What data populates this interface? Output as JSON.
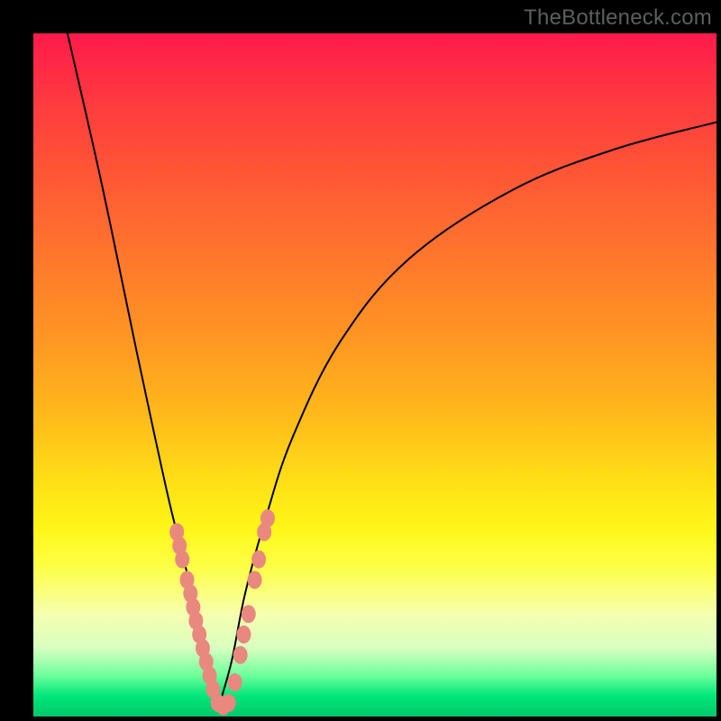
{
  "watermark": "TheBottleneck.com",
  "colors": {
    "frame": "#000000",
    "curve": "#000000",
    "dot": "#e9887f",
    "gradient_top": "#ff1a4b",
    "gradient_bottom": "#00c86a"
  },
  "chart_data": {
    "type": "line",
    "title": "",
    "xlabel": "",
    "ylabel": "",
    "xlim": [
      0,
      100
    ],
    "ylim": [
      0,
      100
    ],
    "description": "Bottleneck/mismatch curve: two black curves converge at a minimum near x≈27 with value ≈0, rising steeply to either side on a vertical color gradient (green at bottom = good, red at top = severe).",
    "series": [
      {
        "name": "left-curve",
        "x": [
          5,
          10,
          15,
          18,
          20,
          22,
          24,
          25,
          26,
          27
        ],
        "values": [
          100,
          78,
          54,
          40,
          31,
          23,
          15,
          10,
          5,
          1
        ]
      },
      {
        "name": "right-curve",
        "x": [
          27,
          29,
          31,
          34,
          38,
          45,
          55,
          70,
          85,
          100
        ],
        "values": [
          1,
          8,
          18,
          29,
          41,
          55,
          67,
          77,
          83,
          87
        ]
      }
    ],
    "markers": [
      {
        "x": 21.0,
        "y": 27
      },
      {
        "x": 21.4,
        "y": 25
      },
      {
        "x": 21.8,
        "y": 23
      },
      {
        "x": 22.5,
        "y": 20
      },
      {
        "x": 23.0,
        "y": 18
      },
      {
        "x": 23.4,
        "y": 16
      },
      {
        "x": 23.8,
        "y": 14
      },
      {
        "x": 24.3,
        "y": 12
      },
      {
        "x": 24.8,
        "y": 10
      },
      {
        "x": 25.3,
        "y": 8
      },
      {
        "x": 25.8,
        "y": 6
      },
      {
        "x": 26.3,
        "y": 4
      },
      {
        "x": 27.0,
        "y": 2
      },
      {
        "x": 27.8,
        "y": 1.5
      },
      {
        "x": 28.6,
        "y": 2
      },
      {
        "x": 29.5,
        "y": 5
      },
      {
        "x": 30.3,
        "y": 9
      },
      {
        "x": 30.8,
        "y": 12
      },
      {
        "x": 31.5,
        "y": 15
      },
      {
        "x": 32.4,
        "y": 20
      },
      {
        "x": 33.0,
        "y": 23
      },
      {
        "x": 33.8,
        "y": 27
      },
      {
        "x": 34.3,
        "y": 29
      }
    ]
  }
}
